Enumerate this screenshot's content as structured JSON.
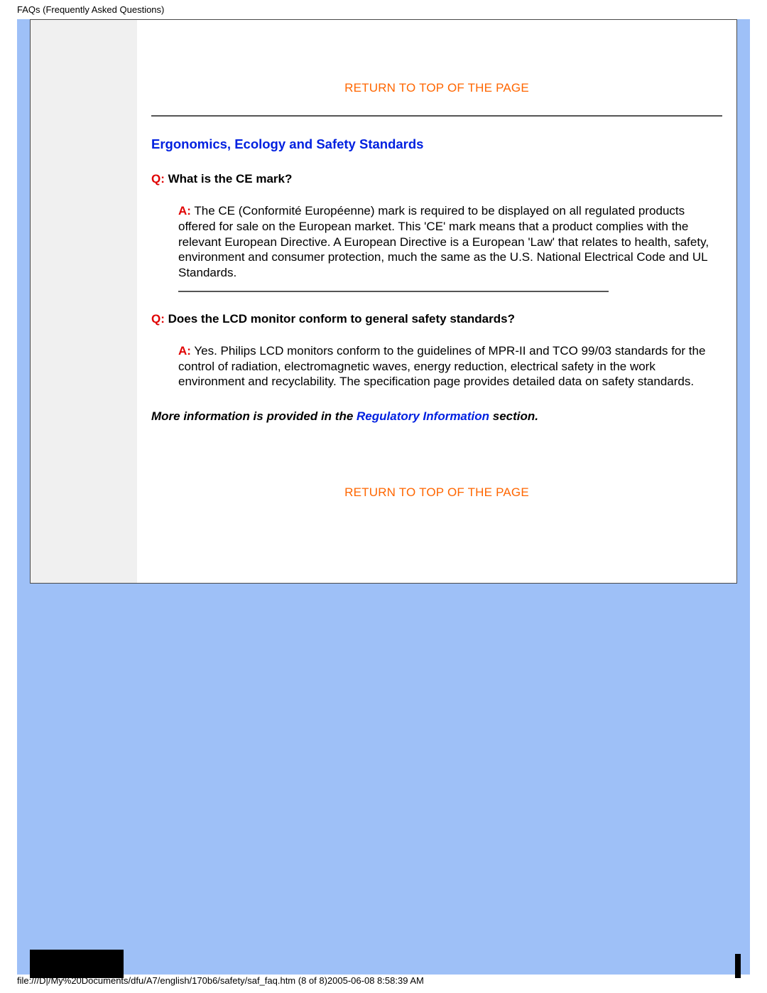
{
  "header": {
    "title": "FAQs (Frequently Asked Questions)"
  },
  "links": {
    "return_top": "RETURN TO TOP OF THE PAGE"
  },
  "section": {
    "title": "Ergonomics, Ecology and Safety Standards"
  },
  "faq1": {
    "q_prefix": "Q:",
    "q_text": " What is the CE mark?",
    "a_prefix": "A:",
    "a_text": " The CE (Conformité Européenne) mark is required to be displayed on all regulated products offered for sale on the European market. This 'CE' mark means that a product complies with the relevant European Directive. A European Directive is a European 'Law' that relates to health, safety, environment and consumer protection, much the same as the U.S. National Electrical Code and UL Standards."
  },
  "faq2": {
    "q_prefix": "Q:",
    "q_text": " Does the LCD monitor conform to general safety standards?",
    "a_prefix": "A:",
    "a_text": " Yes. Philips LCD monitors conform to the guidelines of MPR-II and TCO 99/03 standards for the control of radiation, electromagnetic waves, energy reduction, electrical safety in the work environment and recyclability. The specification page provides detailed data on safety standards."
  },
  "more_info": {
    "pre": "More information is provided in the ",
    "link": "Regulatory Information",
    "post": " section."
  },
  "footer": {
    "path": "file:///D|/My%20Documents/dfu/A7/english/170b6/safety/saf_faq.htm (8 of 8)2005-06-08 8:58:39 AM"
  }
}
